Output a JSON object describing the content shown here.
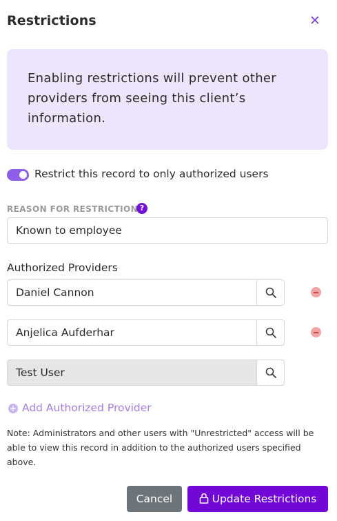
{
  "dialog": {
    "title": "Restrictions",
    "close_icon": "close-icon"
  },
  "alert": {
    "text": "Enabling restrictions will prevent other providers from seeing this client’s information."
  },
  "restrict_toggle": {
    "label": "Restrict this record to only authorized users",
    "checked": true
  },
  "reason": {
    "label": "REASON FOR RESTRICTION",
    "help_icon": "question-icon",
    "value": "Known to employee"
  },
  "authorized_providers": {
    "label": "Authorized Providers",
    "providers": [
      {
        "name": "Daniel Cannon",
        "removable": true,
        "disabled": false
      },
      {
        "name": "Anjelica Aufderhar",
        "removable": true,
        "disabled": false
      },
      {
        "name": "Test User",
        "removable": false,
        "disabled": true
      }
    ],
    "add_label": "Add Authorized Provider"
  },
  "note": "Note: Administrators and other users with \"Unrestricted\" access will be able to view this record in addition to the authorized users specified above.",
  "footer": {
    "cancel_label": "Cancel",
    "update_label": "Update Restrictions"
  },
  "colors": {
    "accent": "#7307d8",
    "alert_bg": "#ece5fb",
    "cancel_bg": "#6d7479",
    "remove": "#f1a3a3"
  }
}
